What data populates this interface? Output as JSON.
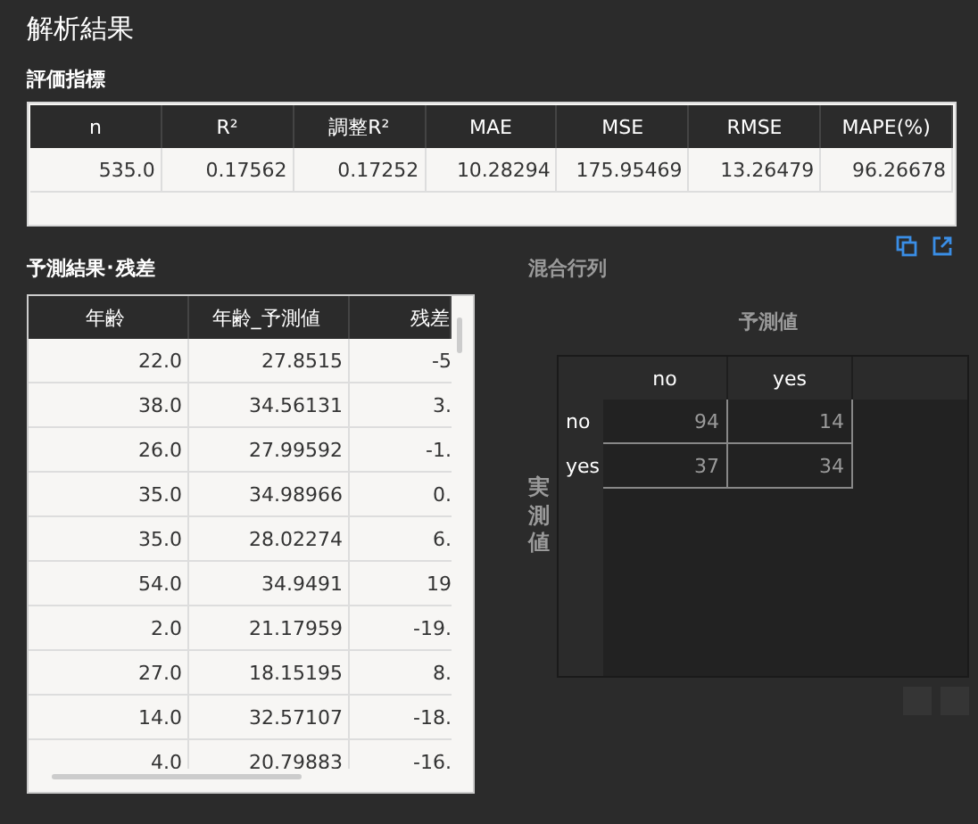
{
  "title": "解析結果",
  "metrics": {
    "heading": "評価指標",
    "columns": [
      "n",
      "R²",
      "調整R²",
      "MAE",
      "MSE",
      "RMSE",
      "MAPE(%)"
    ],
    "row": [
      "535.0",
      "0.17562",
      "0.17252",
      "10.28294",
      "175.95469",
      "13.26479",
      "96.26678"
    ]
  },
  "predictions": {
    "heading": "予測結果･残差",
    "columns": [
      "年齢",
      "年齢_予測値",
      "残差"
    ],
    "rows": [
      [
        "22.0",
        "27.8515",
        "-5"
      ],
      [
        "38.0",
        "34.56131",
        "3."
      ],
      [
        "26.0",
        "27.99592",
        "-1."
      ],
      [
        "35.0",
        "34.98966",
        "0."
      ],
      [
        "35.0",
        "28.02274",
        "6."
      ],
      [
        "54.0",
        "34.9491",
        "19"
      ],
      [
        "2.0",
        "21.17959",
        "-19."
      ],
      [
        "27.0",
        "18.15195",
        "8."
      ],
      [
        "14.0",
        "32.57107",
        "-18."
      ],
      [
        "4.0",
        "20.79883",
        "-16."
      ]
    ]
  },
  "confusion": {
    "heading": "混合行列",
    "predicted_label": "予測値",
    "actual_label": "実測値",
    "columns": [
      "no",
      "yes"
    ],
    "rows": [
      {
        "label": "no",
        "values": [
          "94",
          "14"
        ]
      },
      {
        "label": "yes",
        "values": [
          "37",
          "34"
        ]
      }
    ]
  }
}
